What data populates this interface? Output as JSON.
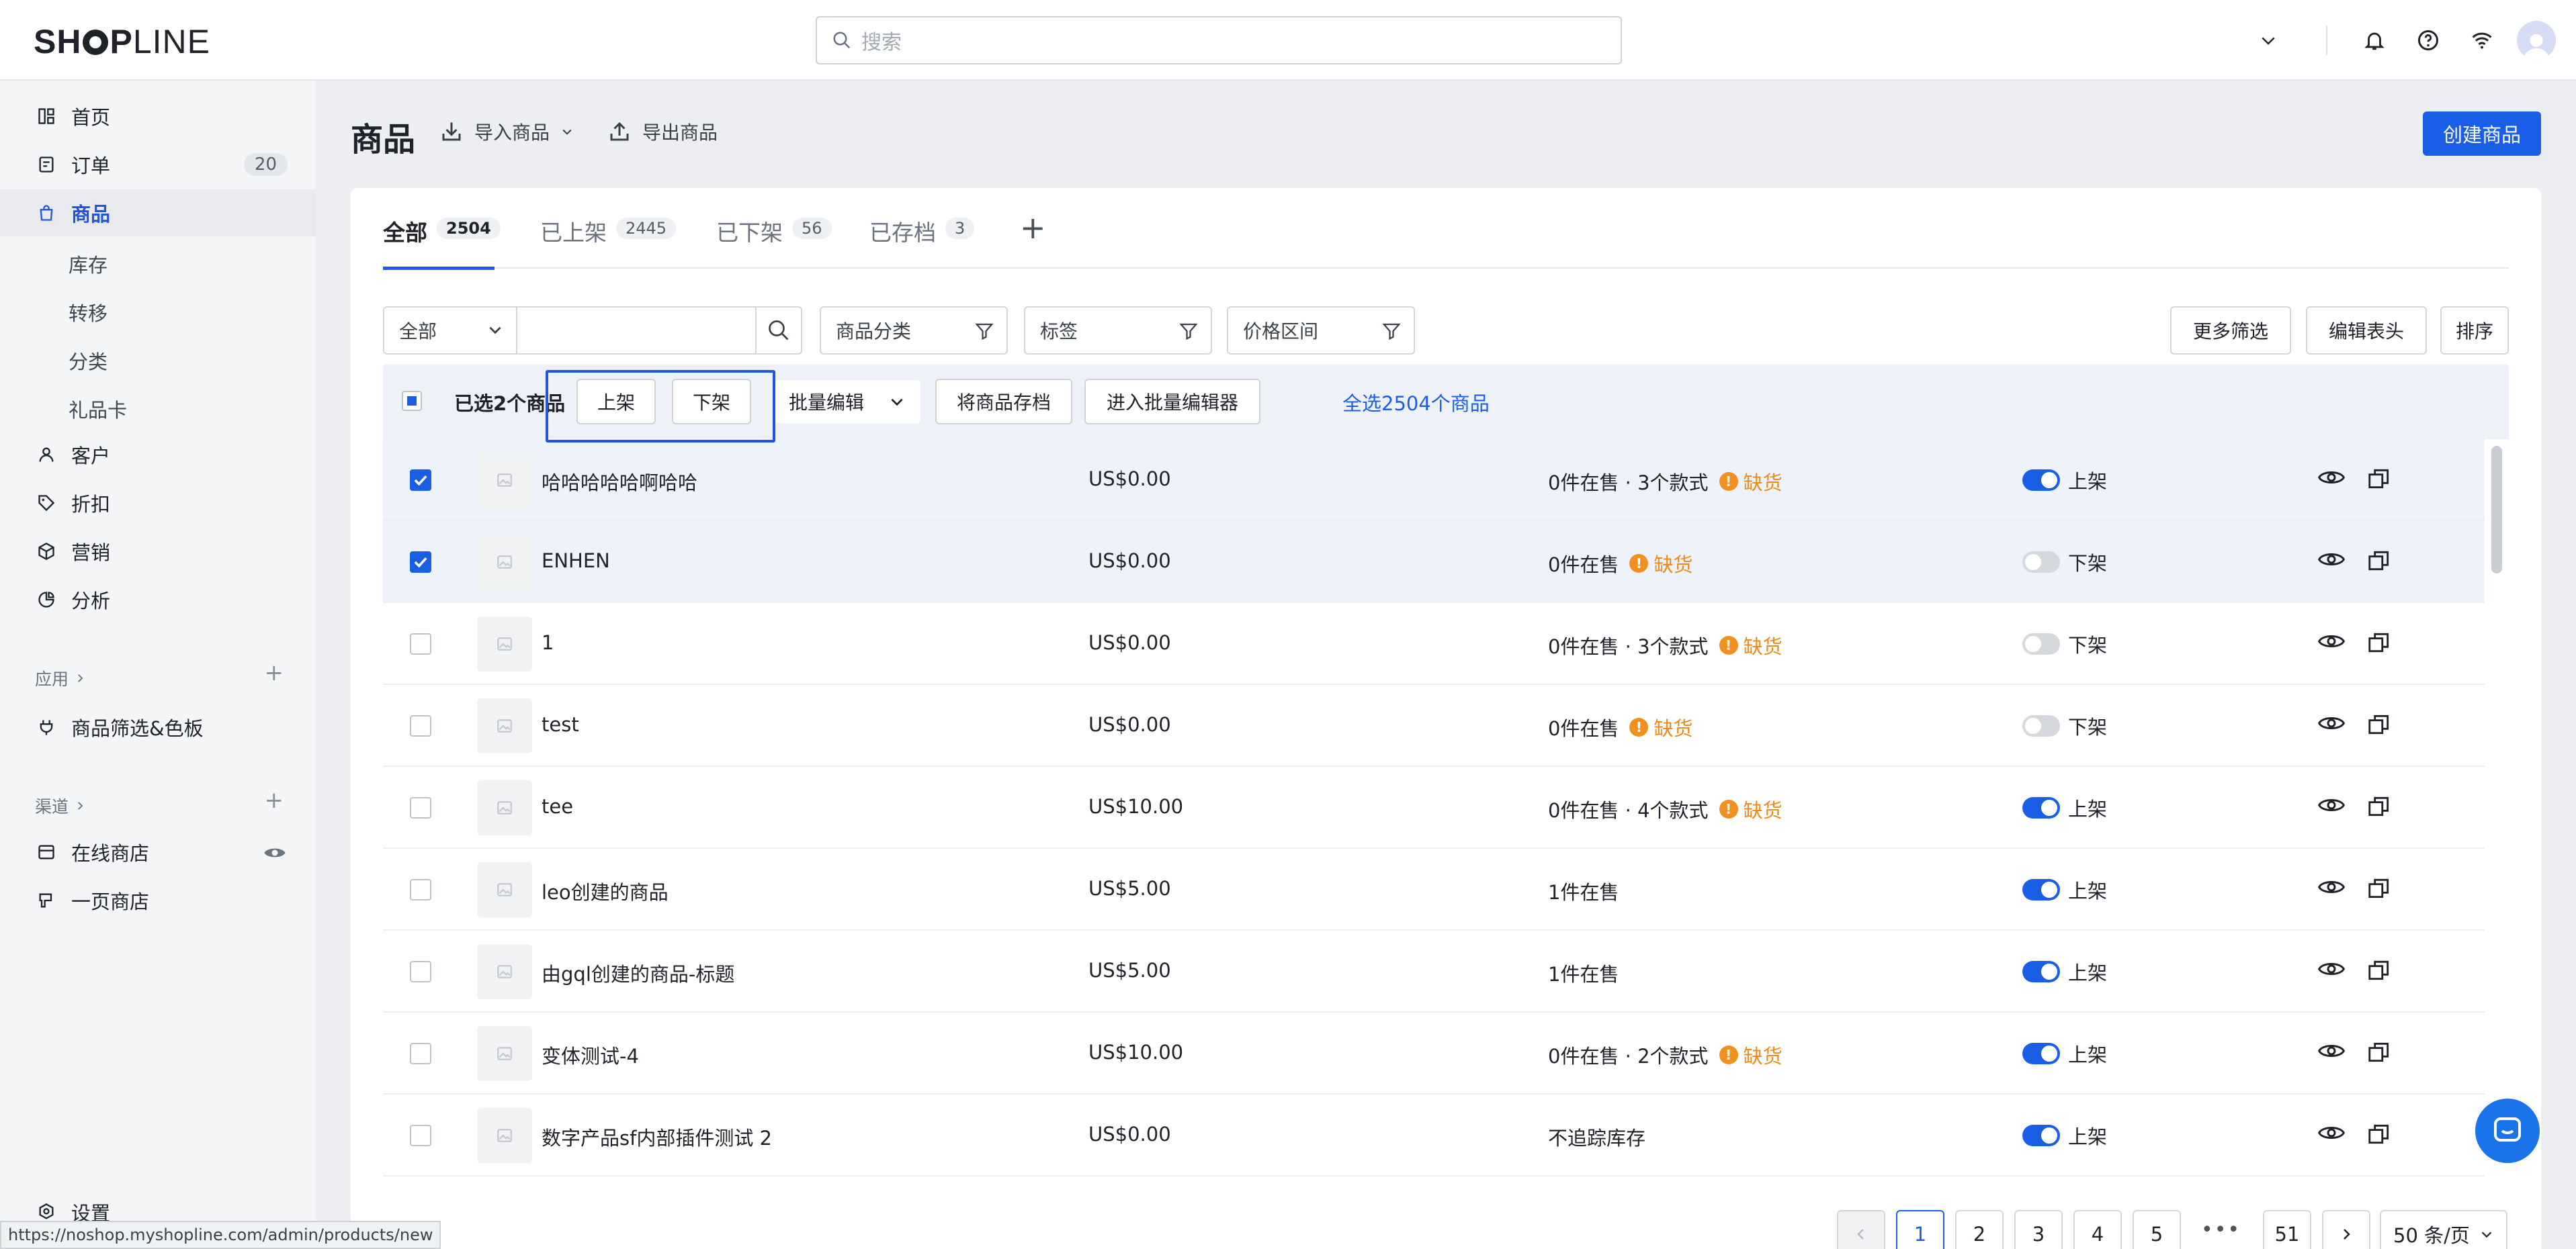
{
  "brand": {
    "logo_left": "SH",
    "logo_mid": "P",
    "logo_right": "LINE"
  },
  "search": {
    "placeholder": "搜索"
  },
  "sidebar": {
    "items": [
      {
        "label": "首页",
        "icon": "dashboard-icon"
      },
      {
        "label": "订单",
        "icon": "order-icon",
        "badge": "20"
      },
      {
        "label": "商品",
        "icon": "bag-icon"
      },
      {
        "label": "客户",
        "icon": "user-icon"
      },
      {
        "label": "折扣",
        "icon": "tag-icon"
      },
      {
        "label": "营销",
        "icon": "marketing-icon"
      },
      {
        "label": "分析",
        "icon": "pie-chart-icon"
      }
    ],
    "sub_items": [
      "库存",
      "转移",
      "分类",
      "礼品卡"
    ],
    "apps_heading": "应用",
    "app_item": "商品筛选&色板",
    "channels_heading": "渠道",
    "channels": [
      "在线商店",
      "一页商店"
    ],
    "settings": "设置"
  },
  "header": {
    "title": "商品",
    "import_label": "导入商品",
    "export_label": "导出商品",
    "create_label": "创建商品"
  },
  "tabs": [
    {
      "label": "全部",
      "count": "2504"
    },
    {
      "label": "已上架",
      "count": "2445"
    },
    {
      "label": "已下架",
      "count": "56"
    },
    {
      "label": "已存档",
      "count": "3"
    }
  ],
  "filters": {
    "scope": "全部",
    "category": "商品分类",
    "tags": "标签",
    "price_range": "价格区间",
    "more_filters": "更多筛选",
    "edit_columns": "编辑表头",
    "sort": "排序"
  },
  "bulk": {
    "selected_text": "已选2个商品",
    "publish": "上架",
    "unpublish": "下架",
    "bulk_edit": "批量编辑",
    "archive": "将商品存档",
    "open_bulk_editor": "进入批量编辑器",
    "select_all": "全选2504个商品"
  },
  "products": [
    {
      "name": "哈哈哈哈哈啊哈哈",
      "price": "US$0.00",
      "stock": "0件在售 · 3个款式",
      "warn": "缺货",
      "status": "上架",
      "on": true,
      "checked": true
    },
    {
      "name": "ENHEN",
      "price": "US$0.00",
      "stock": "0件在售",
      "warn": "缺货",
      "status": "下架",
      "on": false,
      "checked": true
    },
    {
      "name": "1",
      "price": "US$0.00",
      "stock": "0件在售 · 3个款式",
      "warn": "缺货",
      "status": "下架",
      "on": false,
      "checked": false
    },
    {
      "name": "test",
      "price": "US$0.00",
      "stock": "0件在售",
      "warn": "缺货",
      "status": "下架",
      "on": false,
      "checked": false
    },
    {
      "name": "tee",
      "price": "US$10.00",
      "stock": "0件在售 · 4个款式",
      "warn": "缺货",
      "status": "上架",
      "on": true,
      "checked": false
    },
    {
      "name": "leo创建的商品",
      "price": "US$5.00",
      "stock": "1件在售",
      "warn": "",
      "status": "上架",
      "on": true,
      "checked": false
    },
    {
      "name": "由gql创建的商品-标题",
      "price": "US$5.00",
      "stock": "1件在售",
      "warn": "",
      "status": "上架",
      "on": true,
      "checked": false
    },
    {
      "name": "变体测试-4",
      "price": "US$10.00",
      "stock": "0件在售 · 2个款式",
      "warn": "缺货",
      "status": "上架",
      "on": true,
      "checked": false
    },
    {
      "name": "数字产品sf内部插件测试 2",
      "price": "US$0.00",
      "stock": "不追踪库存",
      "warn": "",
      "status": "上架",
      "on": true,
      "checked": false
    }
  ],
  "pagination": {
    "pages": [
      "1",
      "2",
      "3",
      "4",
      "5"
    ],
    "ellipsis": "•••",
    "last": "51",
    "current": "1",
    "per_page": "50 条/页"
  },
  "status_url": "https://noshop.myshopline.com/admin/products/new",
  "colors": {
    "accent": "#1a5ee6",
    "warning": "#f2901f"
  }
}
